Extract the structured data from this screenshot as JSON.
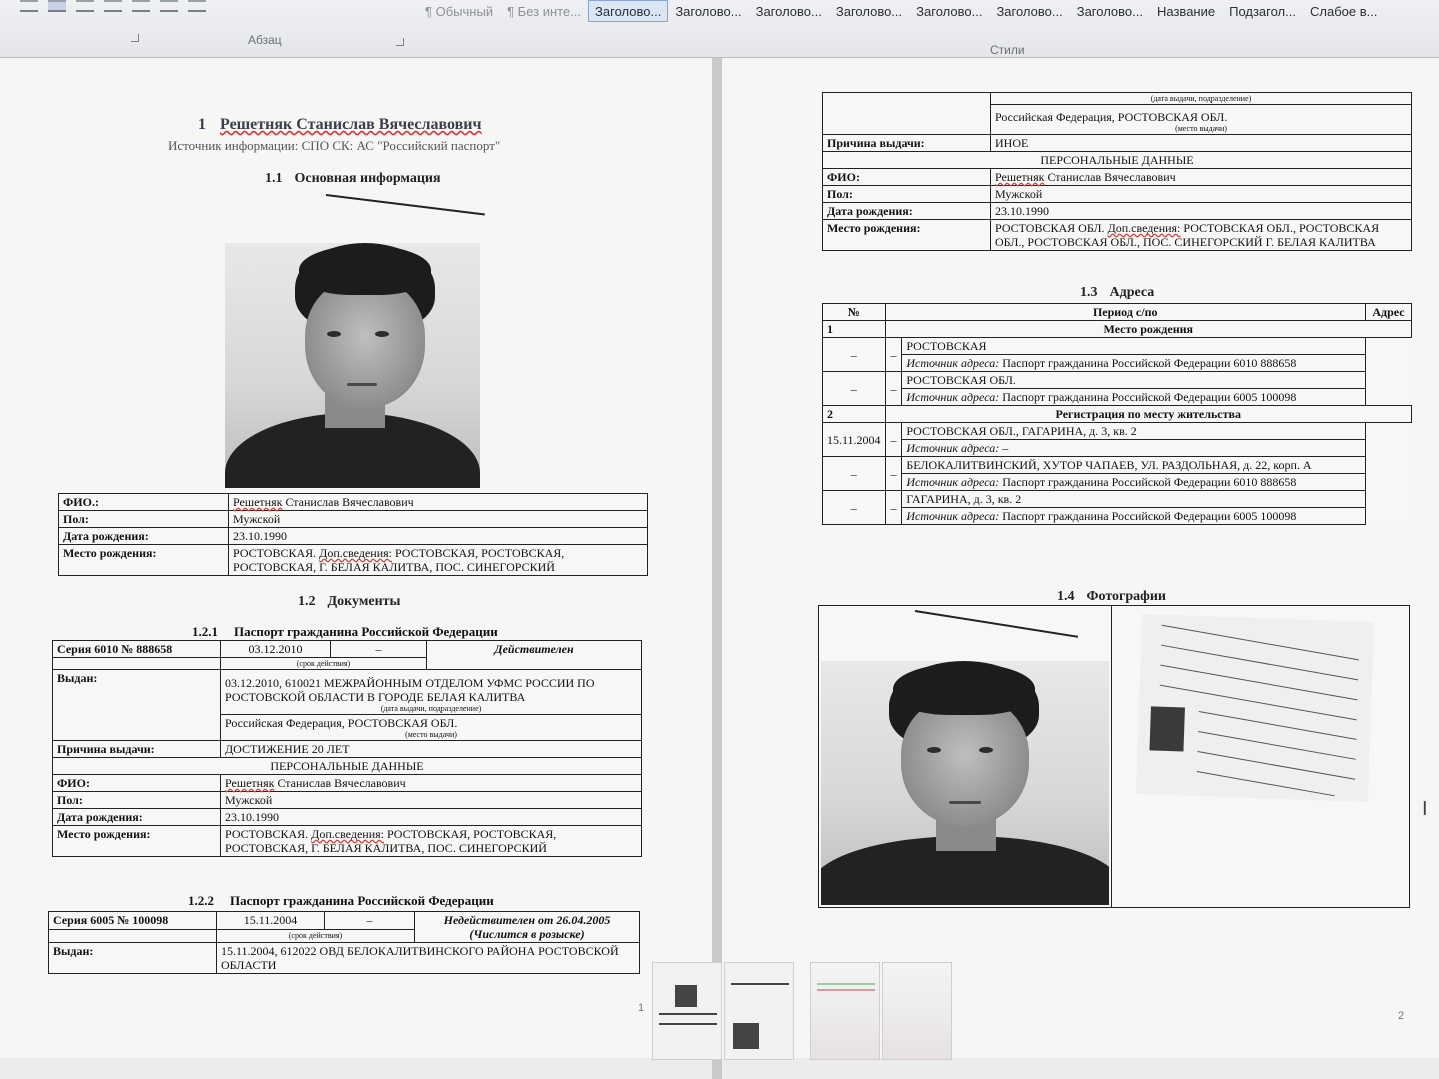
{
  "ribbon": {
    "styles": [
      {
        "label": "¶ Обычный",
        "state": "muted"
      },
      {
        "label": "¶ Без инте...",
        "state": "muted"
      },
      {
        "label": "Заголово...",
        "state": "selected"
      },
      {
        "label": "Заголово...",
        "state": "normal"
      },
      {
        "label": "Заголово...",
        "state": "normal"
      },
      {
        "label": "Заголово...",
        "state": "normal"
      },
      {
        "label": "Заголово...",
        "state": "normal"
      },
      {
        "label": "Заголово...",
        "state": "normal"
      },
      {
        "label": "Заголово...",
        "state": "normal"
      },
      {
        "label": "Название",
        "state": "normal"
      },
      {
        "label": "Подзагол...",
        "state": "normal"
      },
      {
        "label": "Слабое в...",
        "state": "normal"
      }
    ],
    "paragraph_group_label": "Абзац",
    "styles_group_label": "Стили"
  },
  "left_page": {
    "h1_number": "1",
    "h1_name": "Решетняк Станислав Вячеславович",
    "source": "Источник информации: СПО СК: АС \"Российский паспорт\"",
    "h2_main_number": "1.1",
    "h2_main_title": "Основная информация",
    "personal": {
      "fio_label": "ФИО.:",
      "fio_surname": "Решетняк",
      "fio_rest": " Станислав Вячеславович",
      "sex_label": "Пол:",
      "sex_value": "Мужской",
      "dob_label": "Дата рождения:",
      "dob_value": "23.10.1990",
      "pob_label": "Место рождения:",
      "pob_prefix": "РОСТОВСКАЯ. ",
      "pob_extra_label": "Доп.сведения:",
      "pob_rest": " РОСТОВСКАЯ, РОСТОВСКАЯ, РОСТОВСКАЯ, Г. БЕЛАЯ КАЛИТВА, ПОС. СИНЕГОРСКИЙ"
    },
    "h2_docs_number": "1.2",
    "h2_docs_title": "Документы",
    "passport1": {
      "number": "1.2.1",
      "title": "Паспорт гражданина Российской Федерации",
      "series": "Серия 6010 № 888658",
      "issue_date": "03.12.2010",
      "dash": "–",
      "validity_caption": "(срок действия)",
      "status": "Действителен",
      "issued_label": "Выдан:",
      "issued_value": "03.12.2010, 610021 МЕЖРАЙОННЫМ ОТДЕЛОМ УФМС РОССИИ ПО РОСТОВСКОЙ ОБЛАСТИ В ГОРОДЕ БЕЛАЯ КАЛИТВА",
      "issued_caption": "(дата выдачи, подразделение)",
      "place_value": "Российская Федерация, РОСТОВСКАЯ ОБЛ.",
      "place_caption": "(место выдачи)",
      "reason_label": "Причина выдачи:",
      "reason_value": "ДОСТИЖЕНИЕ 20 ЛЕТ",
      "personal_header": "ПЕРСОНАЛЬНЫЕ ДАННЫЕ",
      "fio_label": "ФИО:",
      "fio_surname": "Решетняк",
      "fio_rest": " Станислав Вячеславович",
      "sex_label": "Пол:",
      "sex_value": "Мужской",
      "dob_label": "Дата рождения:",
      "dob_value": "23.10.1990",
      "pob_label": "Место рождения:",
      "pob_prefix": "РОСТОВСКАЯ. ",
      "pob_extra_label": "Доп.сведения:",
      "pob_rest": " РОСТОВСКАЯ, РОСТОВСКАЯ, РОСТОВСКАЯ, Г. БЕЛАЯ КАЛИТВА, ПОС. СИНЕГОРСКИЙ"
    },
    "passport2": {
      "number": "1.2.2",
      "title": "Паспорт гражданина Российской Федерации",
      "series": "Серия 6005 № 100098",
      "issue_date": "15.11.2004",
      "dash": "–",
      "validity_caption": "(срок действия)",
      "status": "Недействителен от 26.04.2005",
      "status_note": "(Числится в розыске)",
      "issued_label": "Выдан:",
      "issued_value": "15.11.2004, 612022 ОВД БЕЛОКАЛИТВИНСКОГО РАЙОНА РОСТОВСКОЙ ОБЛАСТИ"
    },
    "page_number": "1"
  },
  "right_page": {
    "cont": {
      "issued_caption": "(дата выдачи, подразделение)",
      "place_value": "Российская Федерация, РОСТОВСКАЯ ОБЛ.",
      "place_caption": "(место выдачи)",
      "reason_label": "Причина выдачи:",
      "reason_value": "ИНОЕ",
      "personal_header": "ПЕРСОНАЛЬНЫЕ ДАННЫЕ",
      "fio_label": "ФИО:",
      "fio_surname": "Решетняк",
      "fio_rest": " Станислав Вячеславович",
      "sex_label": "Пол:",
      "sex_value": "Мужской",
      "dob_label": "Дата рождения:",
      "dob_value": "23.10.1990",
      "pob_label": "Место рождения:",
      "pob_prefix": "РОСТОВСКАЯ ОБЛ. ",
      "pob_extra_label": "Доп.сведения:",
      "pob_rest": " РОСТОВСКАЯ ОБЛ., РОСТОВСКАЯ ОБЛ., РОСТОВСКАЯ ОБЛ., ПОС. СИНЕГОРСКИЙ Г. БЕЛАЯ КАЛИТВА"
    },
    "addresses": {
      "number": "1.3",
      "title": "Адреса",
      "col_no": "№",
      "col_period": "Период с/по",
      "col_address": "Адрес",
      "group1_no": "1",
      "group1_title": "Место рождения",
      "group2_no": "2",
      "group2_title": "Регистрация по месту жительства",
      "source_label": "Источник адреса:",
      "rows": [
        {
          "from": "–",
          "to": "–",
          "address": "РОСТОВСКАЯ",
          "source": " Паспорт гражданина Российской Федерации 6010 888658"
        },
        {
          "from": "–",
          "to": "–",
          "address": "РОСТОВСКАЯ ОБЛ.",
          "source": " Паспорт гражданина Российской Федерации 6005 100098"
        },
        {
          "from": "15.11.2004",
          "to": "–",
          "address": "РОСТОВСКАЯ ОБЛ., ГАГАРИНА, д. 3, кв. 2",
          "source": " –"
        },
        {
          "from": "–",
          "to": "–",
          "address": "БЕЛОКАЛИТВИНСКИЙ, ХУТОР ЧАПАЕВ, УЛ. РАЗДОЛЬНАЯ, д. 22, корп. А",
          "source": " Паспорт гражданина Российской Федерации 6010 888658"
        },
        {
          "from": "–",
          "to": "–",
          "address": "ГАГАРИНА, д. 3, кв. 2",
          "source": " Паспорт гражданина Российской Федерации 6005 100098"
        }
      ]
    },
    "photos": {
      "number": "1.4",
      "title": "Фотографии"
    },
    "page_number": "2"
  },
  "icons": {
    "photo": "portrait-photo-icon",
    "scan": "application-form-scan-icon",
    "cursor": "text-cursor-icon"
  }
}
